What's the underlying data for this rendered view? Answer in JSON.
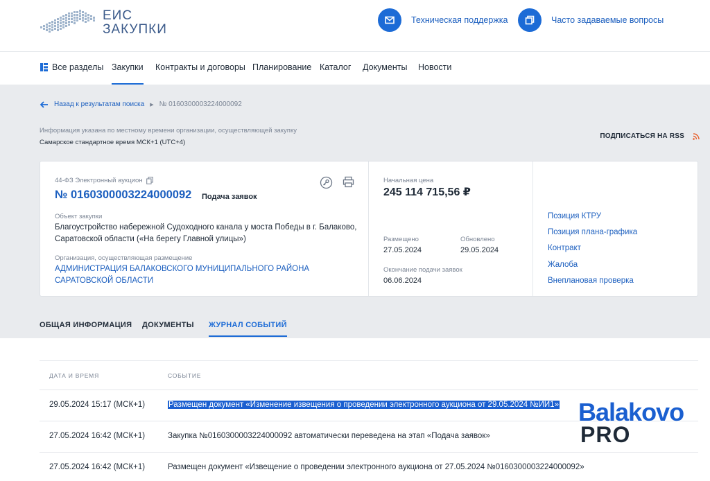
{
  "header": {
    "logo_line1": "ЕИС",
    "logo_line2": "ЗАКУПКИ",
    "support_label": "Техническая поддержка",
    "faq_label": "Часто задаваемые вопросы",
    "accent_color": "#1c6bd6"
  },
  "nav": {
    "items": [
      "Все разделы",
      "Закупки",
      "Контракты и договоры",
      "Планирование",
      "Каталог",
      "Документы",
      "Новости"
    ],
    "active": "Закупки"
  },
  "breadcrumb": {
    "back": "Назад к результатам поиска",
    "current": "№ 0160300003224000092"
  },
  "timezone": {
    "note": "Информация указана по местному времени организации, осуществляющей закупку",
    "value": "Самарское стандартное время МСК+1 (UTC+4)"
  },
  "rss": {
    "label": "ПОДПИСАТЬСЯ НА RSS",
    "icon": "rss-icon"
  },
  "card": {
    "procedure_type": "44-ФЗ Электронный аукцион",
    "number": "№ 0160300003224000092",
    "stage": "Подача заявок",
    "object_label": "Объект закупки",
    "object": "Благоустройство набережной Судоходного канала у моста Победы в г. Балаково, Саратовской области («На берегу Главной улицы»)",
    "org_label": "Организация, осуществляющая размещение",
    "org": "АДМИНИСТРАЦИЯ БАЛАКОВСКОГО МУНИЦИПАЛЬНОГО РАЙОНА САРАТОВСКОЙ ОБЛАСТИ",
    "price_label": "Начальная цена",
    "price": "245 114 715,56 ₽",
    "posted_label": "Размещено",
    "posted": "27.05.2024",
    "updated_label": "Обновлено",
    "updated": "29.05.2024",
    "deadline_label": "Окончание подачи заявок",
    "deadline": "06.06.2024",
    "links": [
      "Позиция КТРУ",
      "Позиция плана-графика",
      "Контракт",
      "Жалоба",
      "Внеплановая проверка"
    ]
  },
  "tabs": {
    "items": [
      "ОБЩАЯ ИНФОРМАЦИЯ",
      "ДОКУМЕНТЫ",
      "ЖУРНАЛ СОБЫТИЙ"
    ],
    "active": "ЖУРНАЛ СОБЫТИЙ"
  },
  "journal": {
    "col_date": "ДАТА И ВРЕМЯ",
    "col_event": "СОБЫТИЕ",
    "rows": [
      {
        "date": "29.05.2024 15:17 (МСК+1)",
        "event": "Размещен документ «Изменение извещения о проведении электронного аукциона от 29.05.2024 №ИИ1»",
        "selected": true
      },
      {
        "date": "27.05.2024 16:42 (МСК+1)",
        "event": "Закупка №0160300003224000092 автоматически переведена на этап «Подача заявок»",
        "selected": false
      },
      {
        "date": "27.05.2024 16:42 (МСК+1)",
        "event": "Размещен документ «Извещение о проведении электронного аукциона от 27.05.2024 №0160300003224000092»",
        "selected": false
      }
    ]
  },
  "watermark": {
    "line1": "Balakovo",
    "line2": "PRO"
  }
}
